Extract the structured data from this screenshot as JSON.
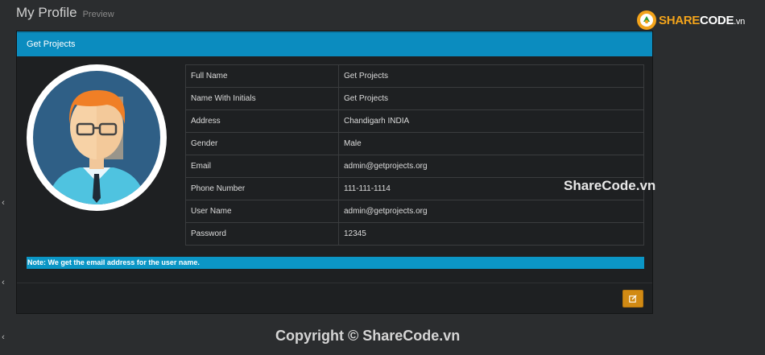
{
  "page": {
    "title": "My Profile",
    "subtitle": "Preview"
  },
  "brand": {
    "share": "SHARE",
    "code": "CODE",
    "suffix": ".vn"
  },
  "panel": {
    "heading": "Get Projects",
    "avatar_icon": "user-avatar",
    "fields": [
      {
        "label": "Full Name",
        "value": "Get Projects"
      },
      {
        "label": "Name With Initials",
        "value": "Get Projects"
      },
      {
        "label": "Address",
        "value": "Chandigarh INDIA"
      },
      {
        "label": "Gender",
        "value": "Male"
      },
      {
        "label": "Email",
        "value": "admin@getprojects.org"
      },
      {
        "label": "Phone Number",
        "value": "111-111-1114"
      },
      {
        "label": "User Name",
        "value": "admin@getprojects.org"
      },
      {
        "label": "Password",
        "value": "12345"
      }
    ],
    "note": "Note: We get the email address for the user name.",
    "edit_icon": "edit-icon"
  },
  "side_arrows": [
    "‹",
    "‹",
    "‹"
  ],
  "watermarks": {
    "middle": "ShareCode.vn",
    "bottom": "Copyright © ShareCode.vn"
  },
  "colors": {
    "heading_bg": "#0b8cbf",
    "note_bg": "#0b96c6",
    "edit_button": "#d18a14",
    "brand_orange": "#f2a31b"
  }
}
